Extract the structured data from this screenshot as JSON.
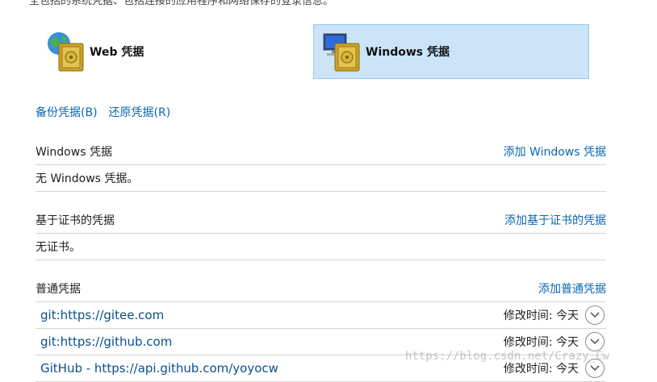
{
  "top_text": "全包括的系统凭据、包括连接的应用程序和网络保存的登录信息。",
  "tiles": {
    "web": {
      "label": "Web 凭据",
      "icon": "web-credentials-icon"
    },
    "windows": {
      "label": "Windows 凭据",
      "icon": "windows-credentials-icon",
      "selected": true
    }
  },
  "links": {
    "backup": "备份凭据(B)",
    "restore": "还原凭据(R)"
  },
  "sections": {
    "windows": {
      "title": "Windows 凭据",
      "add": "添加 Windows 凭据",
      "empty": "无 Windows 凭据。"
    },
    "certificate": {
      "title": "基于证书的凭据",
      "add": "添加基于证书的凭据",
      "empty": "无证书。"
    },
    "generic": {
      "title": "普通凭据",
      "add": "添加普通凭据",
      "items": [
        {
          "name": "git:https://gitee.com",
          "modified": "修改时间: 今天"
        },
        {
          "name": "git:https://github.com",
          "modified": "修改时间: 今天"
        },
        {
          "name": "GitHub - https://api.github.com/yoyocw",
          "modified": "修改时间: 今天"
        }
      ]
    }
  },
  "watermark": "https://blog.csdn.net/Crazy_Cw",
  "colors": {
    "link": "#0a66b4",
    "selected_tile_bg": "#cce4f7",
    "selected_tile_border": "#99c9ef"
  }
}
